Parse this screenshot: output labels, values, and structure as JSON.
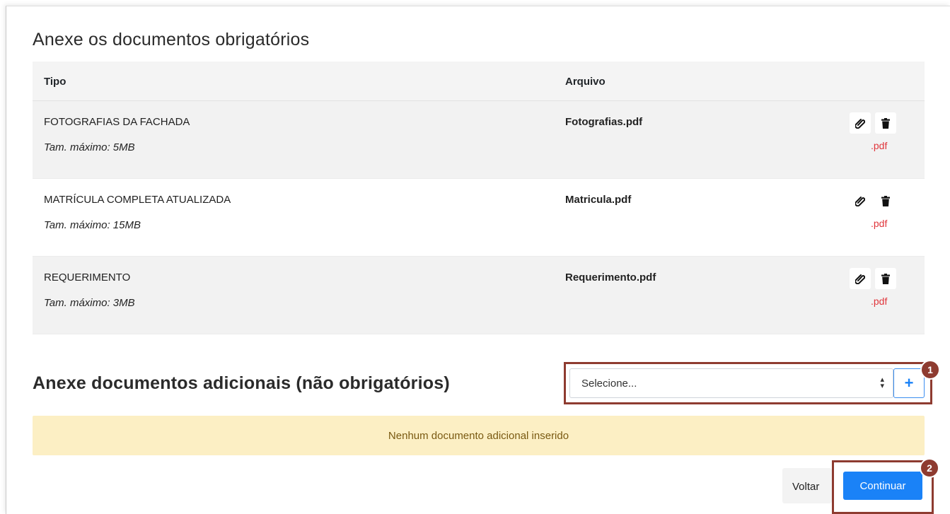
{
  "required_section": {
    "title": "Anexe os documentos obrigatórios",
    "columns": {
      "tipo": "Tipo",
      "arquivo": "Arquivo"
    },
    "rows": [
      {
        "tipo": "FOTOGRAFIAS DA FACHADA",
        "tam": "Tam. máximo: 5MB",
        "file": "Fotografias.pdf",
        "ext": ".pdf"
      },
      {
        "tipo": "MATRÍCULA COMPLETA ATUALIZADA",
        "tam": "Tam. máximo: 15MB",
        "file": "Matricula.pdf",
        "ext": ".pdf"
      },
      {
        "tipo": "REQUERIMENTO",
        "tam": "Tam. máximo: 3MB",
        "file": "Requerimento.pdf",
        "ext": ".pdf"
      }
    ]
  },
  "additional_section": {
    "title": "Anexe documentos adicionais (não obrigatórios)",
    "select_value": "Selecione...",
    "add_label": "+",
    "empty_message": "Nenhum documento adicional inserido"
  },
  "annotations": {
    "badge1": "1",
    "badge2": "2"
  },
  "footer": {
    "back_label": "Voltar",
    "continue_label": "Continuar"
  },
  "icons": {
    "attach": "paperclip-icon",
    "delete": "trash-icon",
    "select_arrows": "sort-arrows-icon"
  },
  "colors": {
    "primary": "#1a82f7",
    "highlight": "#8e3b30",
    "ext": "#e0353b",
    "alert_bg": "#fcefc4"
  }
}
